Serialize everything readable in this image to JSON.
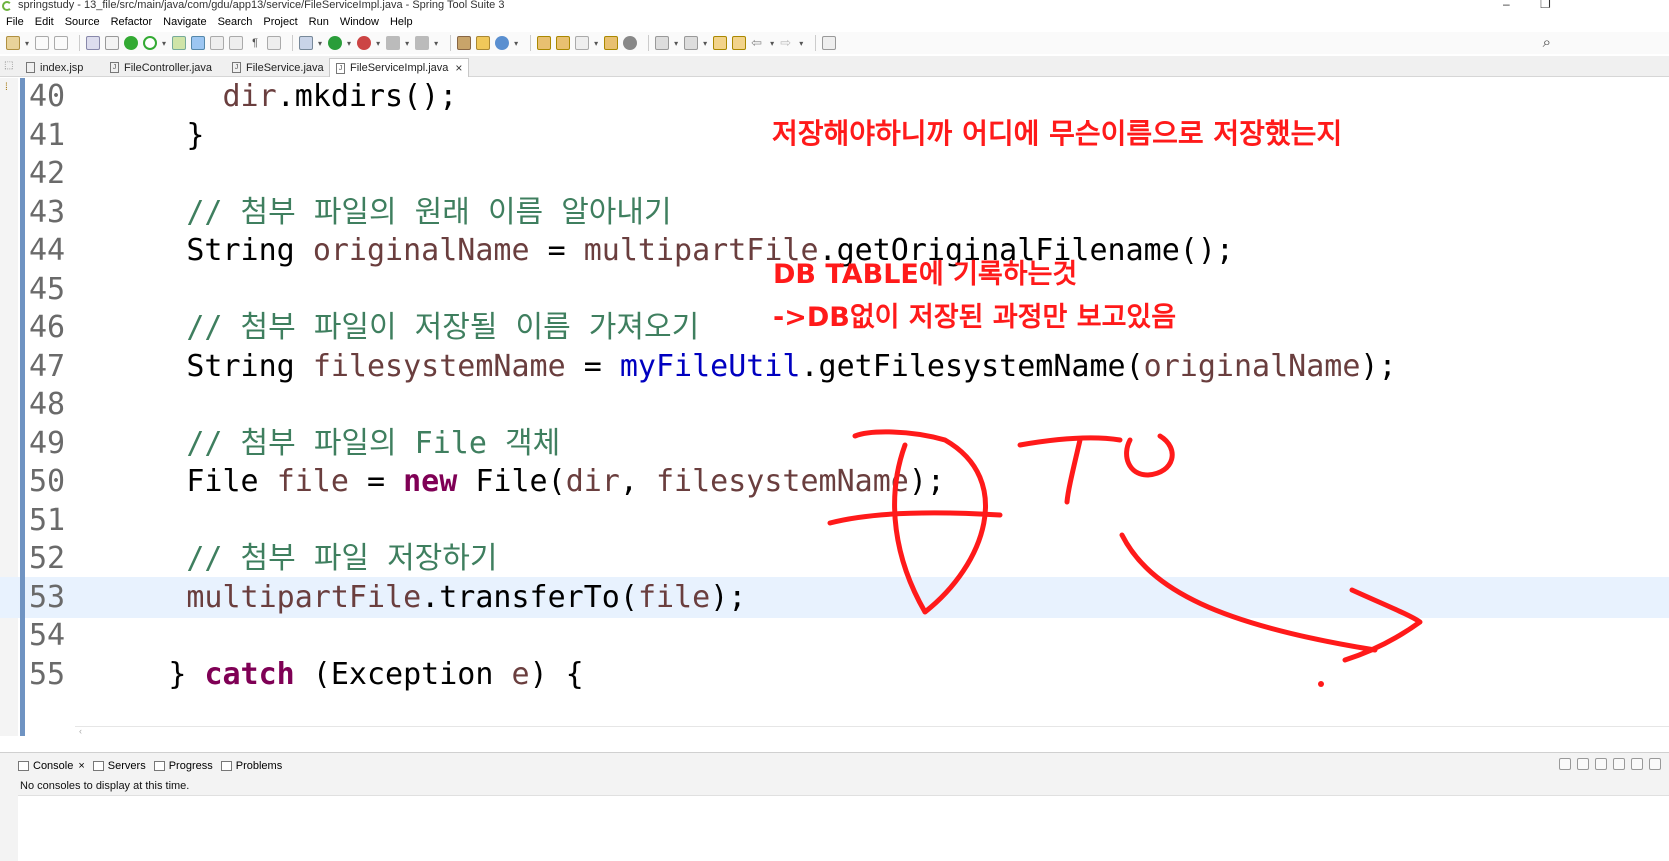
{
  "window": {
    "title": "springstudy - 13_file/src/main/java/com/gdu/app13/service/FileServiceImpl.java - Spring Tool Suite 3",
    "minimize": "–",
    "restore": "❐"
  },
  "menu": [
    "File",
    "Edit",
    "Source",
    "Refactor",
    "Navigate",
    "Search",
    "Project",
    "Run",
    "Window",
    "Help"
  ],
  "toolbar": {
    "search_icon": "search-icon"
  },
  "tabs": [
    {
      "label": "index.jsp",
      "active": false
    },
    {
      "label": "FileController.java",
      "active": false
    },
    {
      "label": "FileService.java",
      "active": false
    },
    {
      "label": "FileServiceImpl.java",
      "active": true,
      "close": "×"
    }
  ],
  "editor": {
    "lines": [
      {
        "num": "40",
        "indent": "        ",
        "parts": [
          [
            "var",
            "dir"
          ],
          [
            "dec",
            ".mkdirs();"
          ]
        ]
      },
      {
        "num": "41",
        "indent": "      ",
        "parts": [
          [
            "dec",
            "}"
          ]
        ]
      },
      {
        "num": "42",
        "indent": "",
        "parts": []
      },
      {
        "num": "43",
        "indent": "      ",
        "parts": [
          [
            "cmt",
            "// 첨부 파일의 원래 이름 알아내기"
          ]
        ]
      },
      {
        "num": "44",
        "indent": "      ",
        "parts": [
          [
            "dec",
            "String "
          ],
          [
            "var",
            "originalName"
          ],
          [
            "dec",
            " = "
          ],
          [
            "var",
            "multipartFile"
          ],
          [
            "dec",
            ".getOriginalFilename();"
          ]
        ]
      },
      {
        "num": "45",
        "indent": "",
        "parts": []
      },
      {
        "num": "46",
        "indent": "      ",
        "parts": [
          [
            "cmt",
            "// 첨부 파일이 저장될 이름 가져오기"
          ]
        ]
      },
      {
        "num": "47",
        "indent": "      ",
        "parts": [
          [
            "dec",
            "String "
          ],
          [
            "var",
            "filesystemName"
          ],
          [
            "dec",
            " = "
          ],
          [
            "field",
            "myFileUtil"
          ],
          [
            "dec",
            ".getFilesystemName("
          ],
          [
            "var",
            "originalName"
          ],
          [
            "dec",
            ");"
          ]
        ]
      },
      {
        "num": "48",
        "indent": "",
        "parts": []
      },
      {
        "num": "49",
        "indent": "      ",
        "parts": [
          [
            "cmt",
            "// 첨부 파일의 File 객체"
          ]
        ]
      },
      {
        "num": "50",
        "indent": "      ",
        "parts": [
          [
            "dec",
            "File "
          ],
          [
            "var",
            "file"
          ],
          [
            "dec",
            " = "
          ],
          [
            "kw",
            "new"
          ],
          [
            "dec",
            " File("
          ],
          [
            "var",
            "dir"
          ],
          [
            "dec",
            ", "
          ],
          [
            "var",
            "filesystemName"
          ],
          [
            "dec",
            ");"
          ]
        ]
      },
      {
        "num": "51",
        "indent": "",
        "parts": []
      },
      {
        "num": "52",
        "indent": "      ",
        "parts": [
          [
            "cmt",
            "// 첨부 파일 저장하기"
          ]
        ]
      },
      {
        "num": "53",
        "indent": "      ",
        "parts": [
          [
            "var",
            "multipartFile"
          ],
          [
            "dec",
            ".transferTo("
          ],
          [
            "var",
            "file"
          ],
          [
            "dec",
            ");"
          ]
        ],
        "current": true
      },
      {
        "num": "54",
        "indent": "",
        "parts": []
      },
      {
        "num": "55",
        "indent": "     ",
        "parts": [
          [
            "dec",
            "} "
          ],
          [
            "kw",
            "catch"
          ],
          [
            "dec",
            " (Exception "
          ],
          [
            "var",
            "e"
          ],
          [
            "dec",
            ") {"
          ]
        ]
      }
    ]
  },
  "annotations": {
    "note1": "저장해야하니까 어디에 무슨이름으로 저장했는지",
    "note2": "DB TABLE에 기록하는것",
    "note3": "->DB없이 저장된 과정만 보고있음",
    "color": "#ff1a1a"
  },
  "bottom_panel": {
    "tabs": [
      {
        "label": "Console",
        "icon": "console-icon",
        "close": "×"
      },
      {
        "label": "Servers",
        "icon": "servers-icon"
      },
      {
        "label": "Progress",
        "icon": "progress-icon"
      },
      {
        "label": "Problems",
        "icon": "problems-icon"
      }
    ],
    "message": "No consoles to display at this time."
  }
}
